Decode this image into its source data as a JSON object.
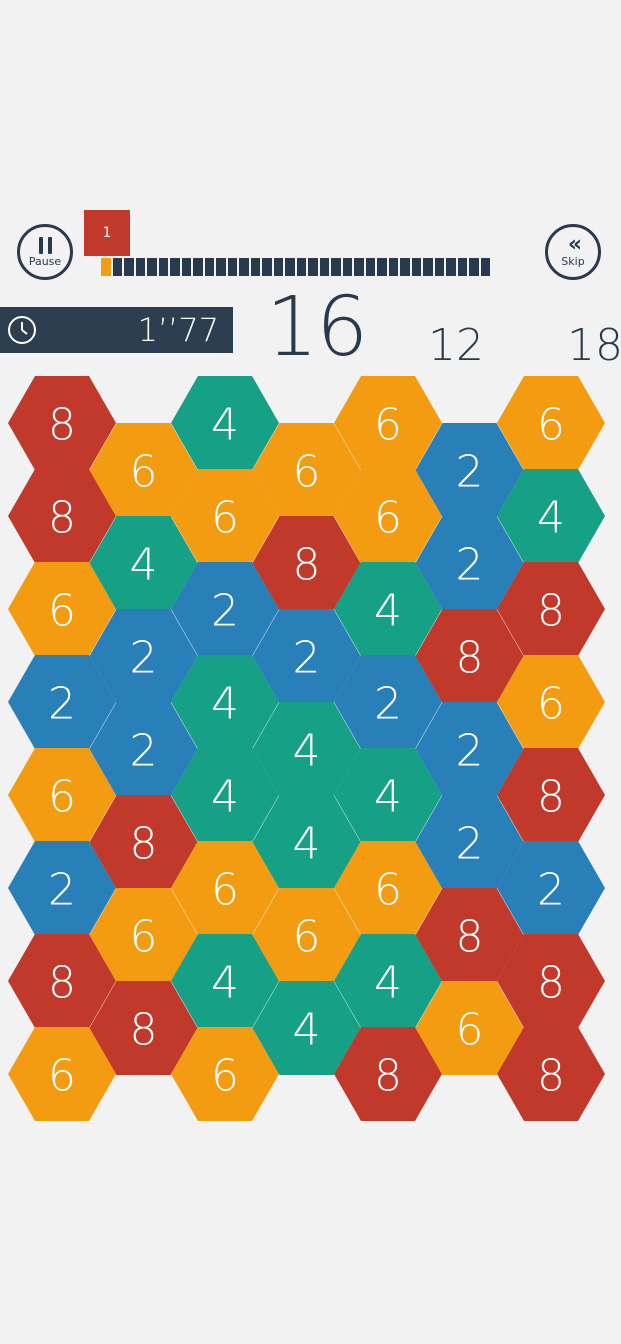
{
  "header": {
    "pause_label": "Pause",
    "skip_label": "Skip",
    "level": "1",
    "progress": {
      "total_segments": 34,
      "completed_segments": 1
    }
  },
  "timer": {
    "value": "1’’77",
    "icon": "clock-icon"
  },
  "scores": {
    "current": "16",
    "next": "12",
    "target": "18"
  },
  "colors": {
    "red": "#c0392b",
    "orange": "#f39c12",
    "teal": "#16a085",
    "blue": "#2980b9",
    "dark": "#2c3e50"
  },
  "board": {
    "columns": [
      [
        "8",
        "8",
        "6",
        "2",
        "6",
        "2",
        "8",
        "6"
      ],
      [
        "6",
        "4",
        "2",
        "2",
        "8",
        "6",
        "8"
      ],
      [
        "4",
        "6",
        "2",
        "4",
        "4",
        "6",
        "4",
        "6"
      ],
      [
        "6",
        "8",
        "2",
        "4",
        "4",
        "6",
        "4"
      ],
      [
        "6",
        "6",
        "4",
        "2",
        "4",
        "6",
        "4",
        "8"
      ],
      [
        "2",
        "2",
        "8",
        "2",
        "2",
        "8",
        "6"
      ],
      [
        "6",
        "4",
        "8",
        "6",
        "8",
        "2",
        "8",
        "8"
      ]
    ]
  }
}
